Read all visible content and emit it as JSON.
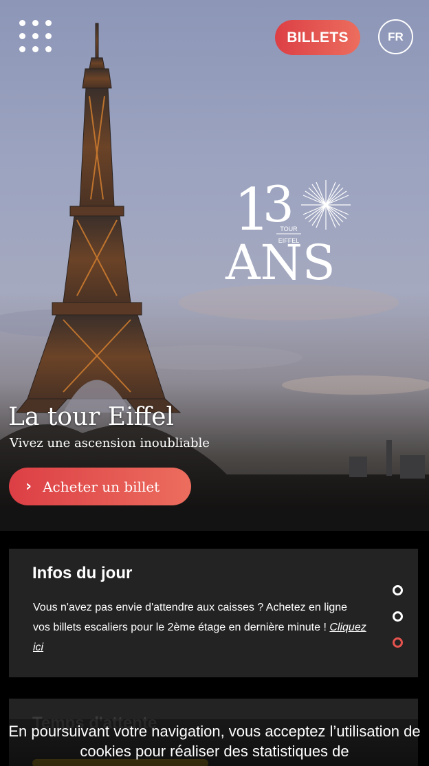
{
  "header": {
    "menu_icon": "grid-dots-icon",
    "billets_label": "BILLETS",
    "lang_label": "FR"
  },
  "logo": {
    "number": "130",
    "tour": "TOUR",
    "eiffel": "EIFFEL",
    "ans": "ANS"
  },
  "hero": {
    "title": "La tour Eiffel",
    "subtitle": "Vivez une ascension inoubliable",
    "cta_label": "Acheter un billet",
    "cta_icon": "chevron-right-icon"
  },
  "infos": {
    "title": "Infos du jour",
    "text": "Vous n'avez pas envie d'attendre aux caisses ? Achetez en ligne vos billets escaliers pour le 2ème étage en dernière minute !",
    "link": "Cliquez ici",
    "slider_index": 3,
    "slider_count": 3
  },
  "wait": {
    "title": "Temps d'attente"
  },
  "cookie": {
    "text": "En poursuivant votre navigation, vous acceptez l’utilisation de cookies pour réaliser des statistiques de"
  },
  "colors": {
    "accent_start": "#dc3f45",
    "accent_end": "#ec6d5e",
    "card_bg": "#232323"
  }
}
